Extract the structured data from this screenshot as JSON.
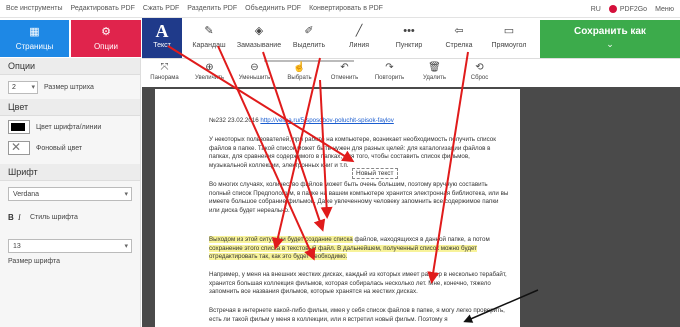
{
  "nav": {
    "items": [
      "Все инструменты",
      "Редактировать PDF",
      "Сжать PDF",
      "Разделить PDF",
      "Объединить PDF",
      "Конвертировать в PDF"
    ],
    "lang": "RU",
    "brand": "PDF2Go",
    "menu": "Меню"
  },
  "left_buttons": {
    "pages": "Страницы",
    "options": "Опции"
  },
  "tools": {
    "active": {
      "glyph": "A",
      "label": "Текст"
    },
    "items": [
      {
        "label": "Карандаш",
        "icon": "pencil-icon"
      },
      {
        "label": "Замазывание",
        "icon": "eraser-icon"
      },
      {
        "label": "Выделить",
        "icon": "highlighter-icon"
      },
      {
        "label": "Линия",
        "icon": "line-icon"
      },
      {
        "label": "Пунктир",
        "icon": "dotted-line-icon"
      },
      {
        "label": "Стрелка",
        "icon": "arrow-icon"
      },
      {
        "label": "Прямоугол",
        "icon": "rectangle-icon"
      }
    ]
  },
  "save": {
    "label": "Сохранить как",
    "chevron": "⌄"
  },
  "actions": [
    "Панорама",
    "Увеличить",
    "Уменьшить",
    "Выбрать",
    "Отменить",
    "Повторить",
    "Удалить",
    "Сброс"
  ],
  "panel": {
    "options_title": "Опции",
    "stroke_size_value": "2",
    "stroke_size_label": "Размер штриха",
    "color_title": "Цвет",
    "font_color_label": "Цвет шрифта/линии",
    "bg_color_label": "Фоновый цвет",
    "font_title": "Шрифт",
    "font_value": "Verdana",
    "bold": "B",
    "italic": "I",
    "font_style_label": "Стиль шрифта",
    "size_value": "13",
    "size_label": "Размер шрифта"
  },
  "document": {
    "header_prefix": "№232 23.02.2016 ",
    "header_link": "http://velisa.ru/5-sposobov-poluchit-spisok-faylov",
    "p1": "У некоторых пользователей, при работе на компьютере, возникает необходимость получить список файлов в папке. Такой список может быть нужен для разных целей: для каталогизации файлов в папках, для сравнения содержимого в папках, для того, чтобы составить список фильмов, музыкальной коллекции, электронных книг и т.п.",
    "new_text": "Новый текст",
    "p2": "Во многих случаях, количество файлов может быть очень большим, поэтому вручную составить полный список Предположим, в папке на вашем компьютере хранится электронная библиотека, или вы имеете большое собрание фильмов. Даже увлеченному человеку запомнить все содержимое папки или диска будет нереально.",
    "p3_hl_a": "Выходом из этой ситуации будет создание списка",
    "p3_plain_a": " файлов, находящихся в данной папке, а потом ",
    "p3_hl_b": "сохранение этого списка в текстовый файл. В дальнейшем, полученный список можно будет отредактировать так, как это будет необходимо.",
    "p4": "Например, у меня на внешних жестких дисках, каждый из которых имеет размер в несколько терабайт, хранится большая коллекция фильмов, которая собиралась несколько лет. Мне, конечно, тяжело запомнить все названия фильмов, которые хранятся на жестких дисках.",
    "p5": "Встречая в интернете какой-либо фильм, имея у себя список файлов в папке, я могу легко проверить, есть ли такой фильм у меня в коллекции, или я встретил новый фильм. Поэтому я"
  },
  "colors": {
    "pages_button": "#1e88e5",
    "options_button": "#e0244c",
    "text_tool": "#1f3a8a",
    "save_button": "#3cab4b",
    "highlight": "#f8f39a",
    "annotation_arrows": "#e01b1b"
  }
}
